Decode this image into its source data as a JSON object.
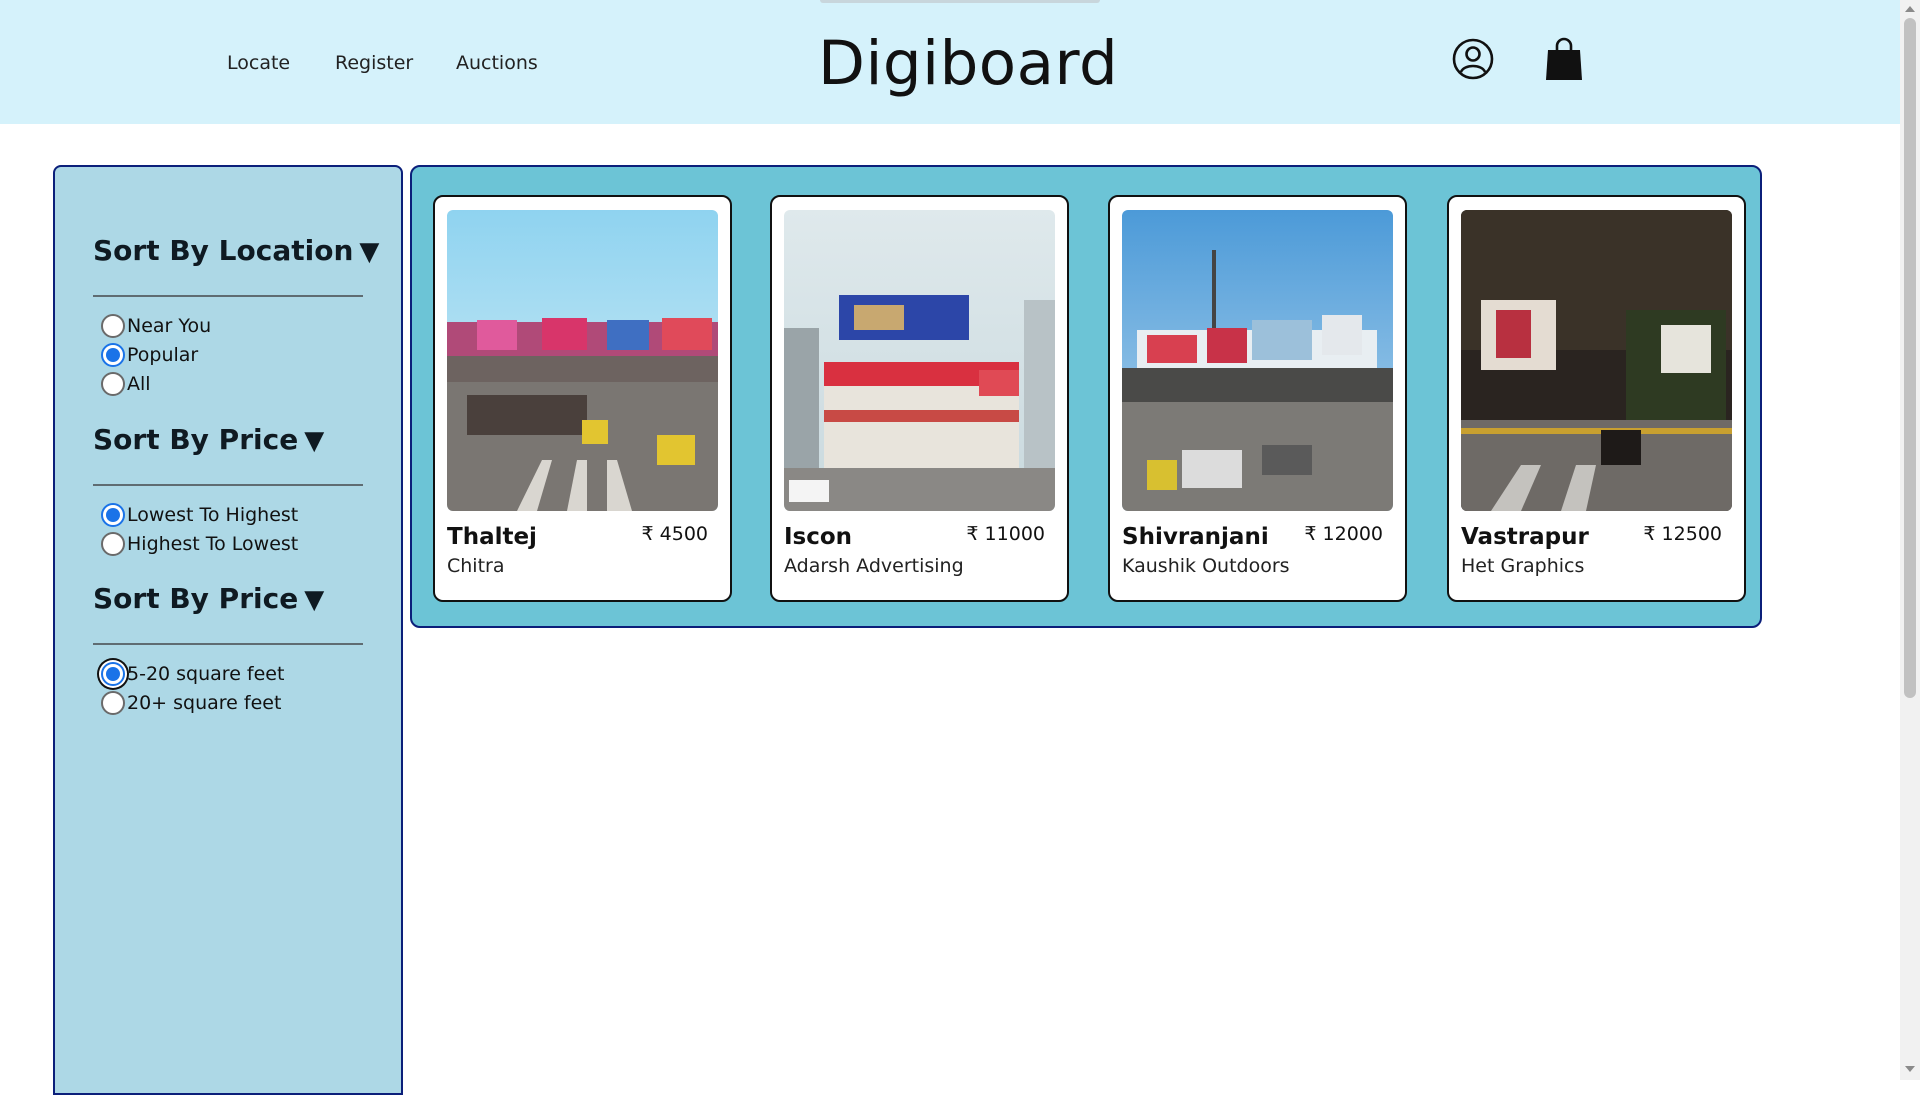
{
  "header": {
    "brand": "Digiboard",
    "nav": [
      {
        "label": "Locate"
      },
      {
        "label": "Register"
      },
      {
        "label": "Auctions"
      }
    ],
    "icons": [
      "user-account-icon",
      "shopping-bag-icon"
    ]
  },
  "sidebar": {
    "sections": [
      {
        "title": "Sort By Location",
        "caret": "▼",
        "options": [
          {
            "label": "Near You",
            "checked": false
          },
          {
            "label": "Popular",
            "checked": true
          },
          {
            "label": "All",
            "checked": false
          }
        ]
      },
      {
        "title": "Sort By Price",
        "caret": "▼",
        "options": [
          {
            "label": "Lowest To Highest",
            "checked": true
          },
          {
            "label": "Highest To Lowest",
            "checked": false
          }
        ]
      },
      {
        "title": "Sort By Price",
        "caret": "▼",
        "options": [
          {
            "label": "5-20 square feet",
            "checked": true
          },
          {
            "label": "20+ square feet",
            "checked": false
          }
        ]
      }
    ]
  },
  "listings": [
    {
      "name": "Thaltej",
      "price": "₹ 4500",
      "vendor": "Chitra"
    },
    {
      "name": "Iscon",
      "price": "₹ 11000",
      "vendor": "Adarsh Advertising"
    },
    {
      "name": "Shivranjani",
      "price": "₹ 12000",
      "vendor": "Kaushik Outdoors"
    },
    {
      "name": "Vastrapur",
      "price": "₹ 12500",
      "vendor": "Het Graphics"
    }
  ],
  "colors": {
    "header_bg": "#d5f2fb",
    "sidebar_bg": "#add8e6",
    "listings_bg": "#6cc4d6",
    "border": "#0b1f7a",
    "radio_accent": "#1a73e8"
  }
}
